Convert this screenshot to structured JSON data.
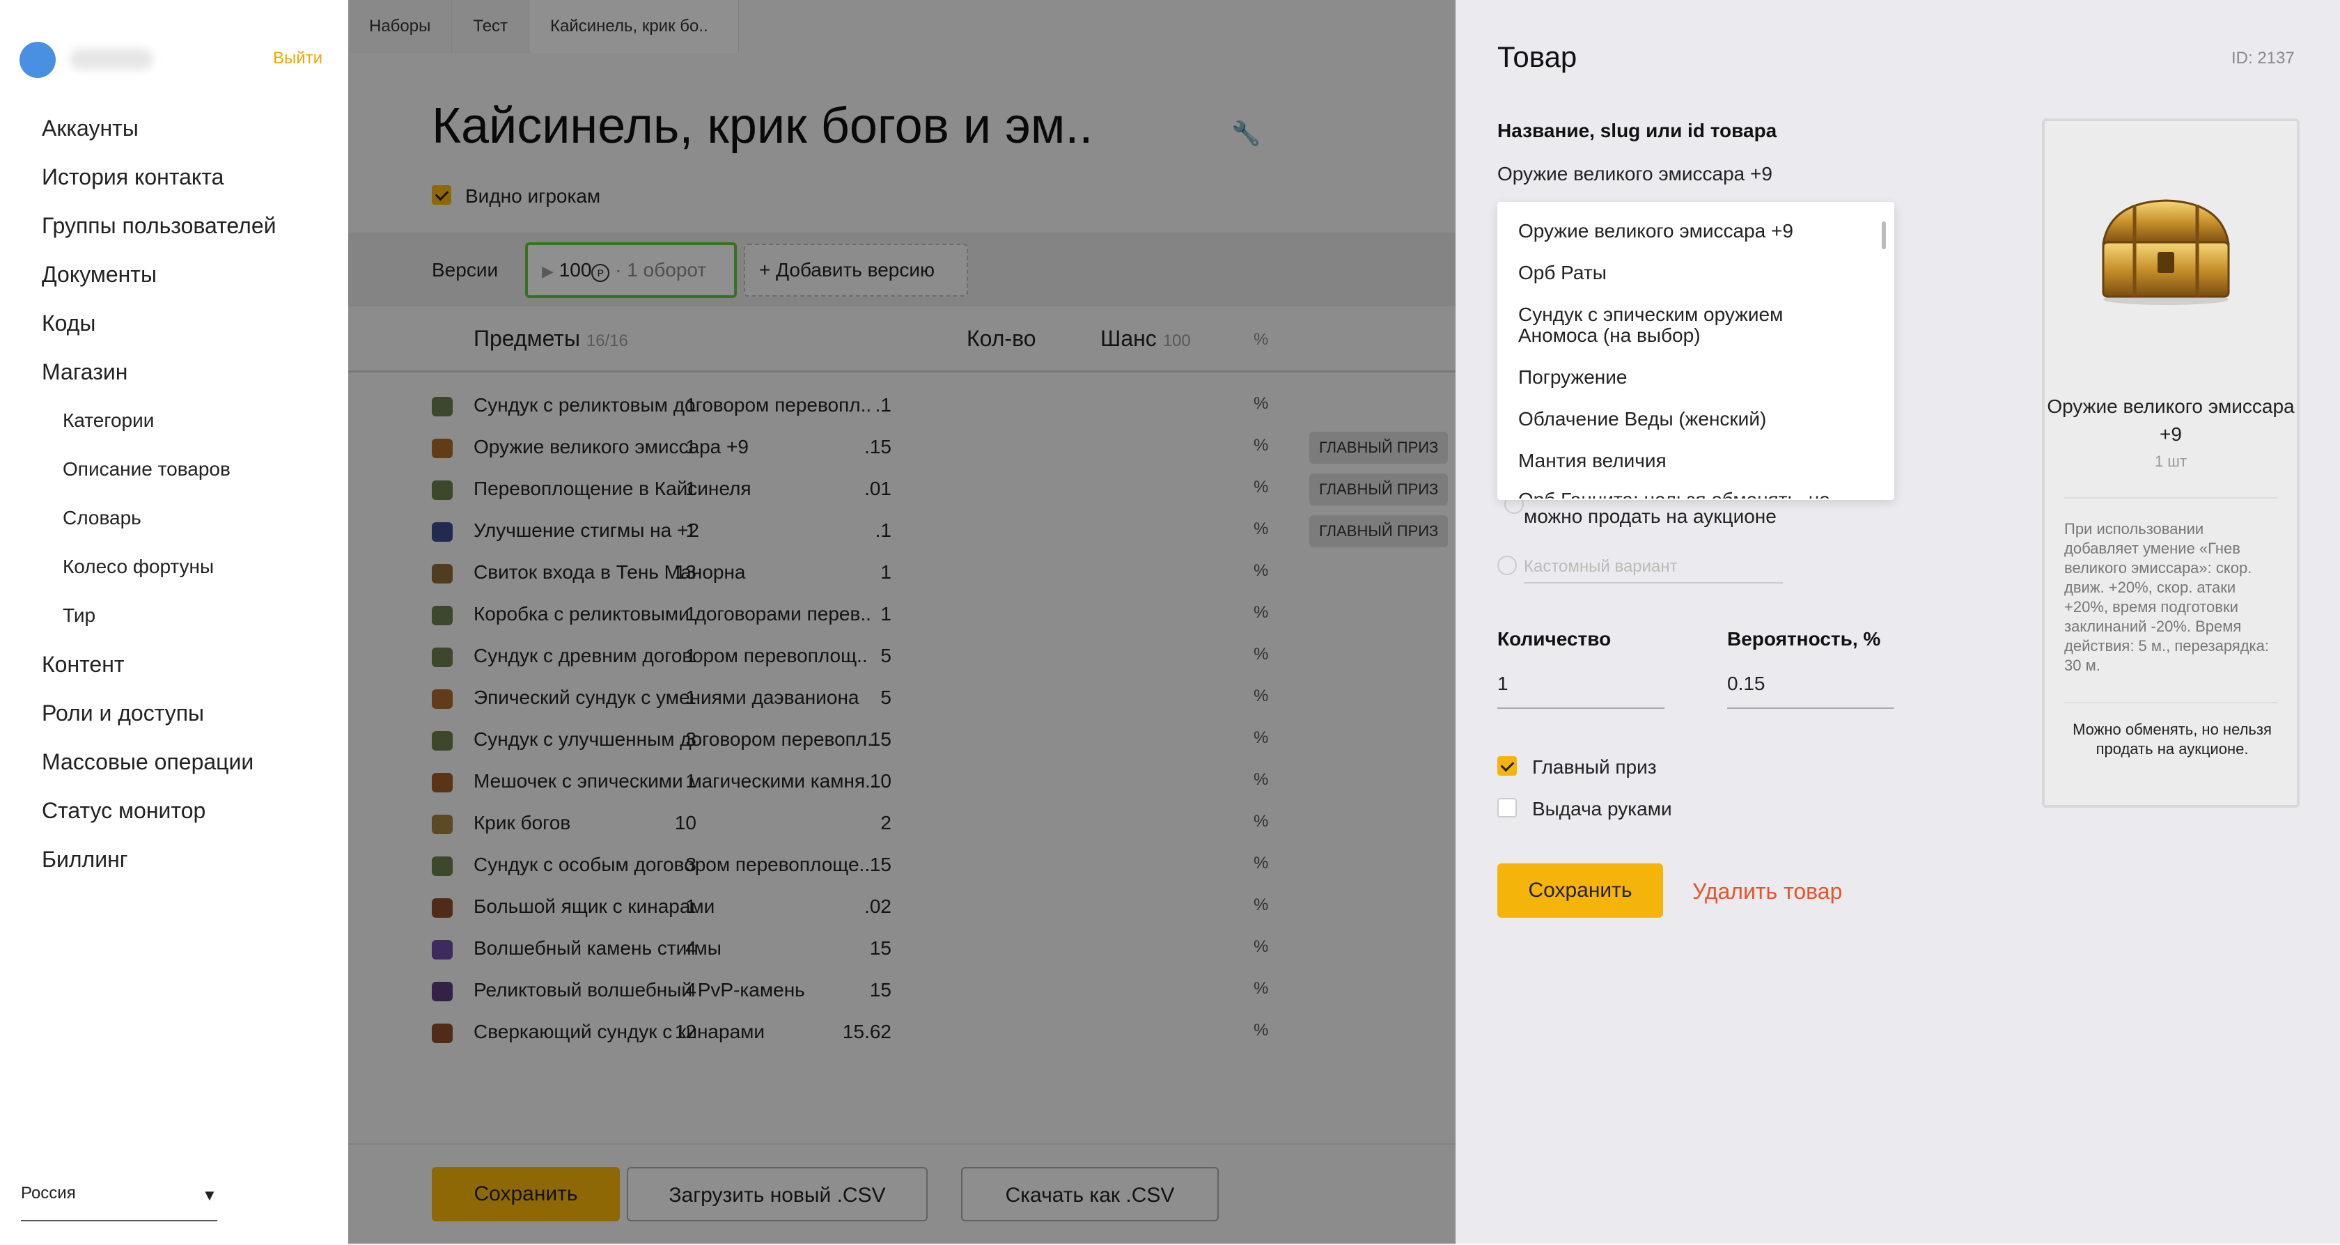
{
  "sidebar": {
    "logout": "Выйти",
    "items": [
      "Аккаунты",
      "История контакта",
      "Группы пользователей",
      "Документы",
      "Коды",
      "Магазин"
    ],
    "shop_sub": [
      "Категории",
      "Описание товаров",
      "Словарь",
      "Колесо фортуны",
      "Тир"
    ],
    "items_after": [
      "Контент",
      "Роли и доступы",
      "Массовые операции",
      "Статус монитор",
      "Биллинг"
    ],
    "region": "Россия"
  },
  "breadcrumbs": [
    "Наборы",
    "Тест",
    "Кайсинель, крик бо.."
  ],
  "page": {
    "title": "Кайсинель, крик богов и эм..",
    "visible_to_players": "Видно игрокам",
    "visible_checked": true,
    "versions_label": "Версии",
    "version": {
      "price": "100",
      "turnover": "· 1 оборот"
    },
    "add_version": "+ Добавить версию"
  },
  "table": {
    "header": {
      "items": "Предметы",
      "items_count": "16/16",
      "qty": "Кол-во",
      "chance": "Шанс",
      "chance_total": "100",
      "percent": "%"
    },
    "rows": [
      {
        "name": "Сундук с реликтовым договором перевопл..",
        "qty": "1",
        "chance": ".1",
        "pct": "%",
        "main": "",
        "icon": "#6a7a4a"
      },
      {
        "name": "Оружие великого эмиссара +9",
        "qty": "1",
        "chance": ".15",
        "pct": "%",
        "main": "ГЛАВНЫЙ ПРИЗ",
        "icon": "#a66a2a"
      },
      {
        "name": "Перевоплощение в Кайсинеля",
        "qty": "1",
        "chance": ".01",
        "pct": "%",
        "main": "ГЛАВНЫЙ ПРИЗ",
        "icon": "#6a7a4a"
      },
      {
        "name": "Улучшение стигмы на +2",
        "qty": "1",
        "chance": ".1",
        "pct": "%",
        "main": "ГЛАВНЫЙ ПРИЗ",
        "icon": "#3a4a8a"
      },
      {
        "name": "Свиток входа в Тень Манорна",
        "qty": "13",
        "chance": "1",
        "pct": "%",
        "main": "",
        "icon": "#8a6a3a"
      },
      {
        "name": "Коробка с реликтовыми договорами перев..",
        "qty": "1",
        "chance": "1",
        "pct": "%",
        "main": "",
        "icon": "#6a7a4a"
      },
      {
        "name": "Сундук с древним договором перевоплощ..",
        "qty": "1",
        "chance": "5",
        "pct": "%",
        "main": "",
        "icon": "#6a7a4a"
      },
      {
        "name": "Эпический сундук с умениями даэваниона",
        "qty": "1",
        "chance": "5",
        "pct": "%",
        "main": "",
        "icon": "#a66a2a"
      },
      {
        "name": "Сундук с улучшенным договором перевопл..",
        "qty": "3",
        "chance": "15",
        "pct": "%",
        "main": "",
        "icon": "#6a7a4a"
      },
      {
        "name": "Мешочек с эпическими магическими камня..",
        "qty": "1",
        "chance": "10",
        "pct": "%",
        "main": "",
        "icon": "#9a5a2a"
      },
      {
        "name": "Крик богов",
        "qty": "10",
        "chance": "2",
        "pct": "%",
        "main": "",
        "icon": "#a08040"
      },
      {
        "name": "Сундук с особым договором перевоплоще..",
        "qty": "3",
        "chance": "15",
        "pct": "%",
        "main": "",
        "icon": "#6a7a4a"
      },
      {
        "name": "Большой ящик с кинарами",
        "qty": "1",
        "chance": ".02",
        "pct": "%",
        "main": "",
        "icon": "#8a4a2a"
      },
      {
        "name": "Волшебный камень стигмы",
        "qty": "4",
        "chance": "15",
        "pct": "%",
        "main": "",
        "icon": "#6a4aa0"
      },
      {
        "name": "Реликтовый волшебный PvP-камень",
        "qty": "4",
        "chance": "15",
        "pct": "%",
        "main": "",
        "icon": "#5a3a7a"
      },
      {
        "name": "Сверкающий сундук с кинарами",
        "qty": "12",
        "chance": "15.62",
        "pct": "%",
        "main": "",
        "icon": "#8a4a2a"
      }
    ]
  },
  "footer": {
    "save": "Сохранить",
    "upload": "Загрузить новый .CSV",
    "download": "Скачать как .CSV"
  },
  "panel": {
    "title": "Товар",
    "id": "ID: 2137",
    "name_label": "Название, slug или id товара",
    "name_value": "Оружие великого эмиссара +9",
    "dropdown": [
      "Оружие великого эмиссара +9",
      "Орб Раты",
      "Сундук с эпическим оружием",
      "Аномоса (на выбор)",
      "Погружение",
      "Облачение Веды (женский)",
      "Мантия величия",
      "Орб Ганнита: нельзя обменять, но"
    ],
    "partial_option": "можно продать на аукционе",
    "custom_placeholder": "Кастомный вариант",
    "qty_label": "Количество",
    "qty_value": "1",
    "prob_label": "Вероятность, %",
    "prob_value": "0.15",
    "main_prize": "Главный приз",
    "main_prize_checked": true,
    "manual": "Выдача руками",
    "manual_checked": false,
    "save": "Сохранить",
    "delete": "Удалить товар"
  },
  "card": {
    "name": "Оружие великого эмиссара +9",
    "qty": "1 шт",
    "description": "При использовании добавляет умение «Гнев великого эмиссара»: скор. движ. +20%, скор. атаки +20%, время подготовки заклинаний -20%. Время действия: 5 м., перезарядка: 30 м.",
    "note": "Можно обменять, но нельзя продать на аукционе."
  },
  "colors": {
    "accent": "#f5b40a",
    "active_version": "#63c23a",
    "delete": "#e8542a"
  }
}
